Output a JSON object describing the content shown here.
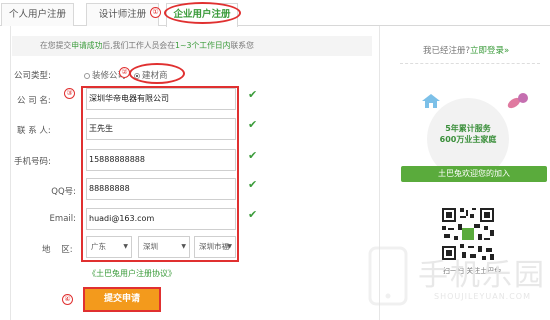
{
  "tabs": [
    {
      "label": "个人用户注册"
    },
    {
      "label": "设计师注册"
    },
    {
      "label": "企业用户注册"
    }
  ],
  "annotations": [
    "①",
    "②",
    "③",
    "④"
  ],
  "notice": {
    "prefix": "在您提交",
    "highlight1": "申请成功",
    "middle": "后,我们工作人员会在",
    "highlight2": "1~3个工作日内",
    "suffix": "联系您"
  },
  "form": {
    "company_type_label": "公司类型:",
    "company_type_options": [
      "装修公司",
      "建材商"
    ],
    "company_name_label": "公 司 名:",
    "company_name_value": "深圳华帝电器有限公司",
    "contact_label": "联 系 人:",
    "contact_value": "王先生",
    "phone_label": "手机号码:",
    "phone_value": "15888888888",
    "qq_label": "QQ号:",
    "qq_value": "88888888",
    "email_label": "Email:",
    "email_value": "huadi@163.com",
    "region_label": "地    区:",
    "region_province": "广东",
    "region_city": "深圳",
    "region_district": "深圳市福",
    "agreement": "《土巴兔用户注册协议》",
    "submit_label": "提交申请"
  },
  "sidebar": {
    "already_text": "我已经注册?",
    "login_link": "立即登录»",
    "stat_line1": "5年累计服务",
    "stat_line2": "600万业主家庭",
    "welcome_text": "土巴兔欢迎您的加入",
    "qr_caption": "扫一扫 关注土巴兔"
  },
  "watermark": {
    "text": "手机乐园",
    "sub": "SHOUJILEYUAN.COM"
  },
  "colors": {
    "accent_green": "#3a9b3a",
    "annotation_red": "#e03030",
    "submit_orange": "#f39a1c"
  }
}
